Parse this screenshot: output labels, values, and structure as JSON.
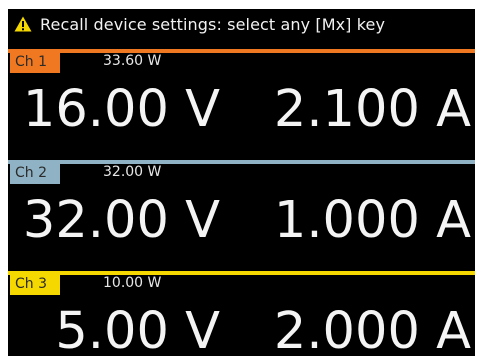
{
  "status": {
    "message": "Recall device settings: select any [Mx] key",
    "icon": "warning-triangle-icon",
    "icon_color": "#f5d800"
  },
  "channels": [
    {
      "tag": "Ch 1",
      "power": "33.60 W",
      "voltage": "16.00 V",
      "current": "2.100 A",
      "color": "#f07820"
    },
    {
      "tag": "Ch 2",
      "power": "32.00 W",
      "voltage": "32.00 V",
      "current": "1.000 A",
      "color": "#8fb3c4"
    },
    {
      "tag": "Ch 3",
      "power": "10.00 W",
      "voltage": "5.00 V",
      "current": "2.000 A",
      "color": "#f5d800"
    }
  ]
}
